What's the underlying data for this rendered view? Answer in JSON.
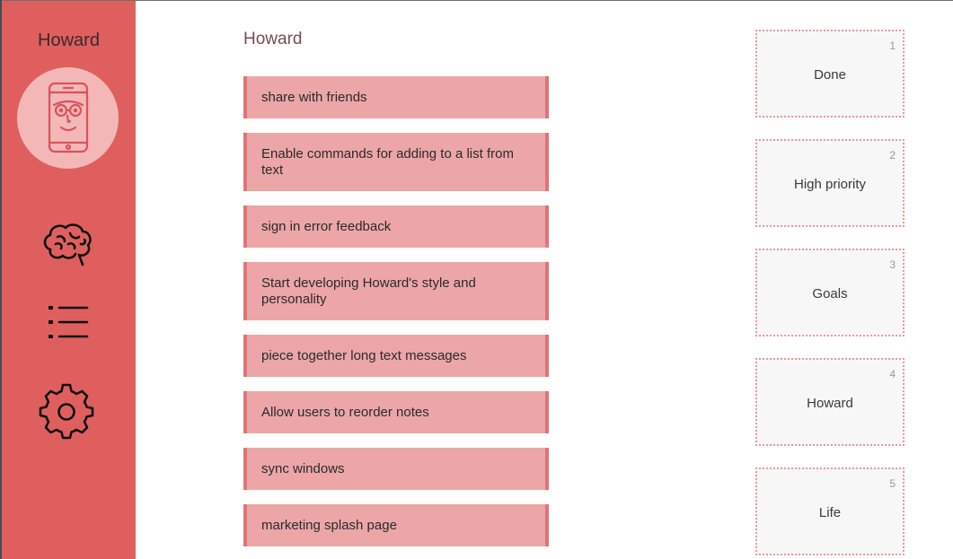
{
  "sidebar": {
    "app_title": "Howard",
    "avatar_icon": "phone-face-icon",
    "nav": [
      {
        "icon": "brain-icon"
      },
      {
        "icon": "list-icon"
      },
      {
        "icon": "gear-icon"
      }
    ],
    "colors": {
      "background": "#df5f5f",
      "avatar_bg": "#f3b7b7"
    }
  },
  "main": {
    "title": "Howard",
    "notes": [
      {
        "text": "share with friends"
      },
      {
        "text": "Enable commands for adding to a list from text"
      },
      {
        "text": "sign in error feedback"
      },
      {
        "text": "Start developing Howard's style and personality"
      },
      {
        "text": "piece together long text messages"
      },
      {
        "text": "Allow users to reorder notes"
      },
      {
        "text": "sync windows"
      },
      {
        "text": "marketing splash page"
      }
    ],
    "colors": {
      "note_bg": "#eca6a8",
      "note_edge": "#e07478"
    }
  },
  "lists": [
    {
      "number": "1",
      "name": "Done"
    },
    {
      "number": "2",
      "name": "High priority"
    },
    {
      "number": "3",
      "name": "Goals"
    },
    {
      "number": "4",
      "name": "Howard"
    },
    {
      "number": "5",
      "name": "Life"
    }
  ]
}
